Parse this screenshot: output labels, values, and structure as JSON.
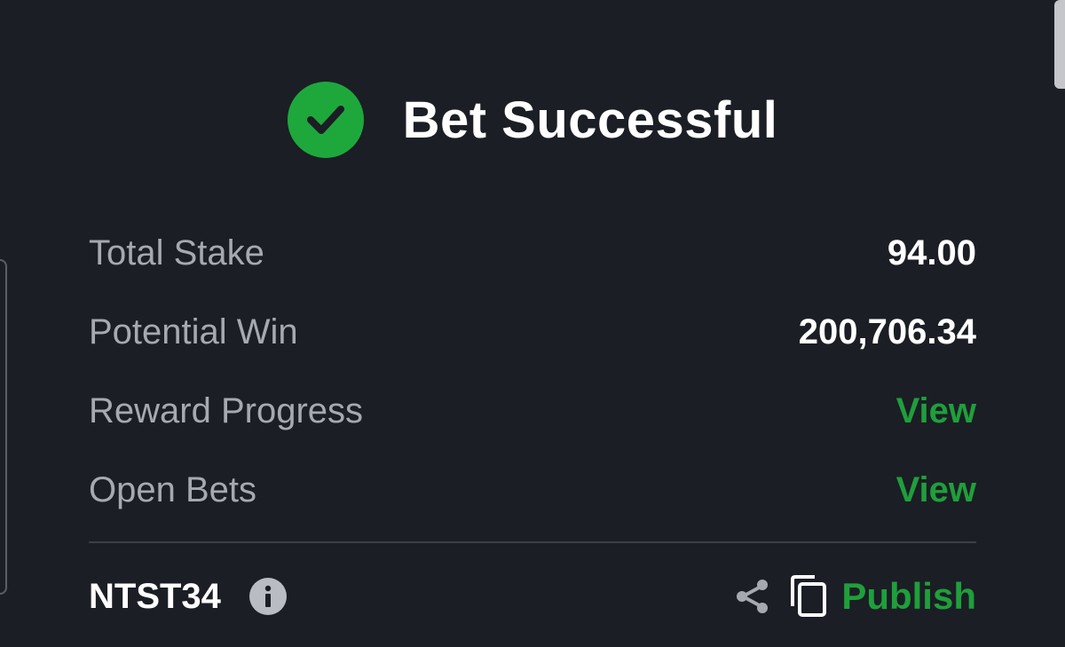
{
  "header": {
    "title": "Bet Successful",
    "icon": "check-circle-icon",
    "icon_color": "#1ea83c"
  },
  "summary": {
    "rows": [
      {
        "label": "Total Stake",
        "value": "94.00"
      },
      {
        "label": "Potential Win",
        "value": "200,706.34"
      },
      {
        "label": "Reward Progress",
        "value": "View"
      },
      {
        "label": "Open Bets",
        "value": "View"
      }
    ]
  },
  "footer": {
    "code": "NTST34",
    "info_icon": "info-icon",
    "share_icon": "share-icon",
    "copy_icon": "copy-icon",
    "publish_label": "Publish"
  },
  "colors": {
    "background": "#1b1e25",
    "accent_green": "#1f9f3b",
    "label_gray": "#a6a9b0",
    "value_white": "#ffffff"
  }
}
